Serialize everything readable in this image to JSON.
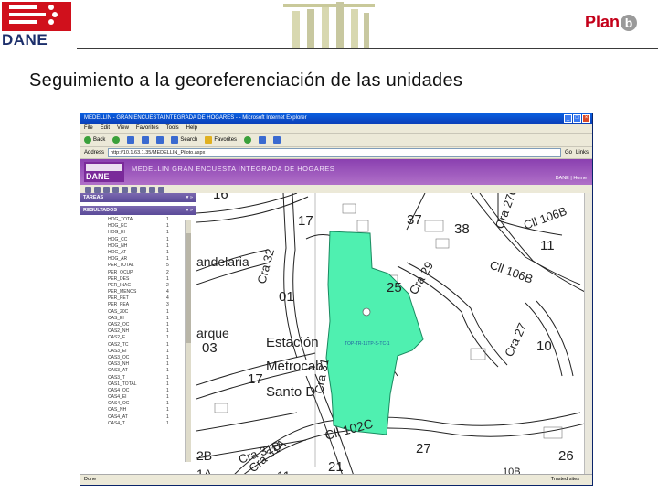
{
  "slide": {
    "logo_text": "DANE",
    "brand": "Plan",
    "brand_b": "b",
    "title": "Seguimiento a la georeferenciación de las unidades"
  },
  "browser": {
    "window_title": "MEDELLIN - GRAN ENCUESTA INTEGRADA DE HOGARES - - Microsoft Internet Explorer",
    "menu": [
      "File",
      "Edit",
      "View",
      "Favorites",
      "Tools",
      "Help"
    ],
    "toolbar": [
      "Back",
      "Search",
      "Favorites"
    ],
    "address_label": "Address",
    "address_value": "http://10.1.63.1.35/MEDELLIN_Piloto.aspx",
    "go_label": "Go",
    "links_label": "Links",
    "status_left": "Done",
    "status_right": "Trusted sites"
  },
  "app": {
    "logo_text": "DANE",
    "title": "MEDELLIN   GRAN ENCUESTA INTEGRADA DE HOGARES",
    "user_links": "DANE | Home"
  },
  "sidebar": {
    "tareas_label": "TAREAS",
    "resultados_label": "RESULTADOS",
    "arrows": "▾ »",
    "rows": [
      {
        "name": "HOG_TOTAL",
        "value": "1"
      },
      {
        "name": "HOG_EC",
        "value": "1"
      },
      {
        "name": "HOG_EI",
        "value": "1"
      },
      {
        "name": "HOG_CC",
        "value": "1"
      },
      {
        "name": "HOG_NH",
        "value": "1"
      },
      {
        "name": "HOG_AT",
        "value": "1"
      },
      {
        "name": "HOG_AR",
        "value": "1"
      },
      {
        "name": "PER_TOTAL",
        "value": "5"
      },
      {
        "name": "PER_OCUP",
        "value": "2"
      },
      {
        "name": "PER_DES",
        "value": "1"
      },
      {
        "name": "PER_INAC",
        "value": "2"
      },
      {
        "name": "PER_MENOS",
        "value": "4"
      },
      {
        "name": "PER_PET",
        "value": "4"
      },
      {
        "name": "PER_PEA",
        "value": "3"
      },
      {
        "name": "CAS_20C",
        "value": "1"
      },
      {
        "name": "CAS_EI",
        "value": "1"
      },
      {
        "name": "CAS2_OC",
        "value": "1"
      },
      {
        "name": "CAS2_NH",
        "value": "1"
      },
      {
        "name": "CAS2_E",
        "value": "1"
      },
      {
        "name": "CAS2_TC",
        "value": "1"
      },
      {
        "name": "CAS3_EI",
        "value": "1"
      },
      {
        "name": "CAS3_OC",
        "value": "1"
      },
      {
        "name": "CAS3_NH",
        "value": "1"
      },
      {
        "name": "CAS3_AT",
        "value": "1"
      },
      {
        "name": "CAS3_T",
        "value": "1"
      },
      {
        "name": "CAS1_TOTAL",
        "value": "1"
      },
      {
        "name": "CAS4_OC",
        "value": "1"
      },
      {
        "name": "CAS4_EI",
        "value": "1"
      },
      {
        "name": "CAS4_OC",
        "value": "1"
      },
      {
        "name": "CAS_NH",
        "value": "1"
      },
      {
        "name": "CAS4_AT",
        "value": "1"
      },
      {
        "name": "CAS4_T",
        "value": "1"
      }
    ]
  },
  "map": {
    "polygon_label": "TOP-TR-11TP-S-TC-1",
    "labels": [
      {
        "text": "16"
      },
      {
        "text": "17"
      },
      {
        "text": "37"
      },
      {
        "text": "38"
      },
      {
        "text": "11"
      },
      {
        "text": "Cll 106B"
      },
      {
        "text": "Cll 106B"
      },
      {
        "text": "Cra 27C"
      },
      {
        "text": "andelaria"
      },
      {
        "text": "Cra 32"
      },
      {
        "text": "01"
      },
      {
        "text": "25"
      },
      {
        "text": "Cra 29"
      },
      {
        "text": "arque"
      },
      {
        "text": "03"
      },
      {
        "text": "Estación"
      },
      {
        "text": "Metrocab"
      },
      {
        "text": "Santo D"
      },
      {
        "text": "17"
      },
      {
        "text": "Cra 31"
      },
      {
        "text": "10"
      },
      {
        "text": "Cra 27"
      },
      {
        "text": "Cll 102C"
      },
      {
        "text": "27"
      },
      {
        "text": "26"
      },
      {
        "text": "21"
      },
      {
        "text": "Cra 31B"
      },
      {
        "text": "Cra 31A"
      },
      {
        "text": "2B"
      },
      {
        "text": "1A"
      },
      {
        "text": "11"
      },
      {
        "text": "10B"
      }
    ]
  },
  "colors": {
    "polygon_fill": "#4ff0b0",
    "app_header": "#9a50b8",
    "title_blue": "#0a3fb8"
  }
}
